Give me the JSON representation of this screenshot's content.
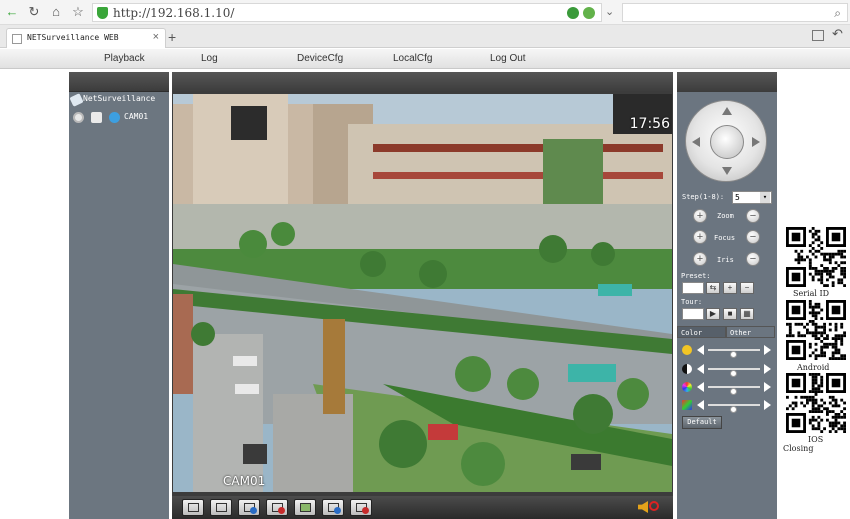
{
  "browser": {
    "url": "http://192.168.1.10/",
    "tab_title": "NETSurveillance WEB",
    "tab_close": "×",
    "new_tab": "+"
  },
  "menu": {
    "items": [
      "Playback",
      "Log",
      "DeviceCfg",
      "LocalCfg",
      "Log Out"
    ]
  },
  "device_tree": {
    "root_label": "NetSurveillance",
    "camera_label": "CAM01"
  },
  "video": {
    "osd_time": "17:56",
    "osd_camera": "CAM01"
  },
  "ptz": {
    "step_label": "Step(1-8):",
    "step_value": "5",
    "zoom_label": "Zoom",
    "focus_label": "Focus",
    "iris_label": "Iris",
    "preset_label": "Preset:",
    "tour_label": "Tour:",
    "color_tab": "Color",
    "other_tab": "Other",
    "default_button": "Default",
    "levels": [
      0.5,
      0.5,
      0.5,
      0.5
    ]
  },
  "qr_codes": {
    "serial_label": "Serial ID",
    "android_label": "Android",
    "ios_label": "IOS",
    "closing_label": "Closing"
  },
  "colors": {
    "panel_bg": "#6c7680",
    "header_dark": "#3c3c3c",
    "accent_green": "#3aa63a"
  }
}
